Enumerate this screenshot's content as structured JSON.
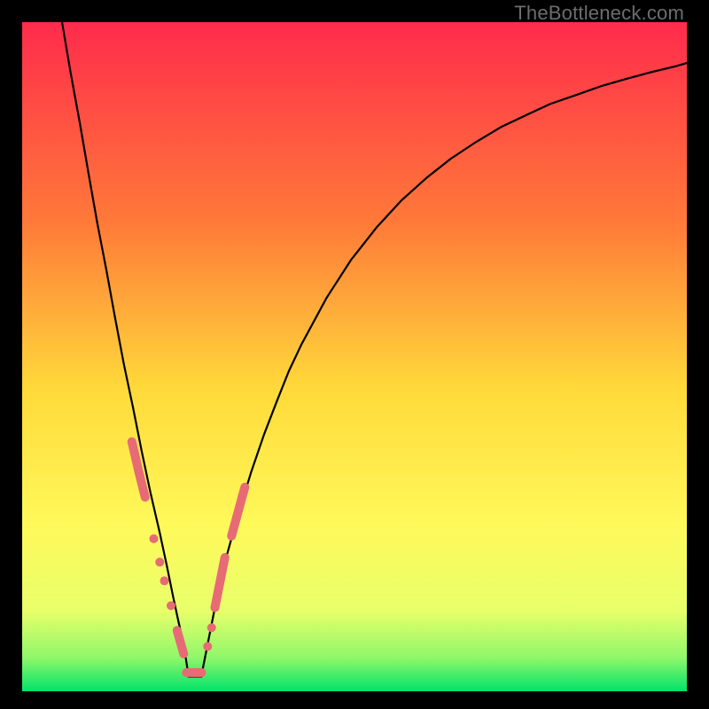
{
  "watermark": "TheBottleneck.com",
  "chart_data": {
    "type": "line",
    "title": "",
    "xlabel": "",
    "ylabel": "",
    "xlim": [
      0,
      1
    ],
    "ylim": [
      0,
      1
    ],
    "grid": false,
    "legend": false,
    "background_gradient": {
      "stops": [
        {
          "offset": 0.0,
          "color": "#ff2b4c"
        },
        {
          "offset": 0.3,
          "color": "#ff7a39"
        },
        {
          "offset": 0.55,
          "color": "#ffda3a"
        },
        {
          "offset": 0.75,
          "color": "#fff95a"
        },
        {
          "offset": 0.88,
          "color": "#e8ff6a"
        },
        {
          "offset": 0.95,
          "color": "#8ff76a"
        },
        {
          "offset": 1.0,
          "color": "#00e36a"
        }
      ]
    },
    "series": [
      {
        "name": "left-branch",
        "color": "#000000",
        "weight": 2.2,
        "x": [
          0.06,
          0.073,
          0.087,
          0.1,
          0.113,
          0.127,
          0.14,
          0.153,
          0.167,
          0.18,
          0.193,
          0.207,
          0.218,
          0.227,
          0.235,
          0.243,
          0.25
        ],
        "y": [
          1.0,
          0.924,
          0.848,
          0.773,
          0.7,
          0.628,
          0.557,
          0.489,
          0.423,
          0.358,
          0.297,
          0.237,
          0.186,
          0.142,
          0.105,
          0.07,
          0.025
        ]
      },
      {
        "name": "right-branch",
        "color": "#000000",
        "weight": 2.2,
        "x": [
          0.27,
          0.289,
          0.307,
          0.326,
          0.345,
          0.364,
          0.383,
          0.401,
          0.42,
          0.458,
          0.495,
          0.533,
          0.57,
          0.608,
          0.645,
          0.683,
          0.72,
          0.758,
          0.795,
          0.833,
          0.87,
          0.908,
          0.945,
          0.983,
          1.0
        ],
        "y": [
          0.025,
          0.12,
          0.2,
          0.268,
          0.329,
          0.384,
          0.433,
          0.478,
          0.518,
          0.588,
          0.645,
          0.693,
          0.733,
          0.767,
          0.796,
          0.821,
          0.843,
          0.861,
          0.878,
          0.891,
          0.904,
          0.915,
          0.925,
          0.934,
          0.939
        ]
      },
      {
        "name": "valley-floor",
        "color": "#000000",
        "weight": 2.2,
        "x": [
          0.25,
          0.27
        ],
        "y": [
          0.022,
          0.022
        ]
      }
    ],
    "marker_segments": [
      {
        "name": "left-high",
        "x": [
          0.165,
          0.175,
          0.185
        ],
        "y": [
          0.373,
          0.33,
          0.29
        ],
        "color": "#e76b75",
        "weight": 10,
        "cap": "round"
      },
      {
        "name": "left-mid",
        "points": [
          {
            "x": 0.198,
            "y": 0.228
          },
          {
            "x": 0.207,
            "y": 0.193
          },
          {
            "x": 0.214,
            "y": 0.165
          },
          {
            "x": 0.224,
            "y": 0.128
          }
        ],
        "color": "#e76b75",
        "radius": 5
      },
      {
        "name": "left-low",
        "x": [
          0.233,
          0.243
        ],
        "y": [
          0.091,
          0.056
        ],
        "color": "#e76b75",
        "weight": 10,
        "cap": "round"
      },
      {
        "name": "bottom",
        "x": [
          0.247,
          0.27
        ],
        "y": [
          0.028,
          0.028
        ],
        "color": "#e76b75",
        "weight": 10,
        "cap": "round"
      },
      {
        "name": "right-low",
        "points": [
          {
            "x": 0.279,
            "y": 0.067
          },
          {
            "x": 0.285,
            "y": 0.095
          }
        ],
        "color": "#e76b75",
        "radius": 5
      },
      {
        "name": "right-mid",
        "x": [
          0.29,
          0.305
        ],
        "y": [
          0.125,
          0.2
        ],
        "color": "#e76b75",
        "weight": 10,
        "cap": "round"
      },
      {
        "name": "right-high",
        "x": [
          0.315,
          0.335
        ],
        "y": [
          0.232,
          0.305
        ],
        "color": "#e76b75",
        "weight": 10,
        "cap": "round"
      }
    ]
  }
}
